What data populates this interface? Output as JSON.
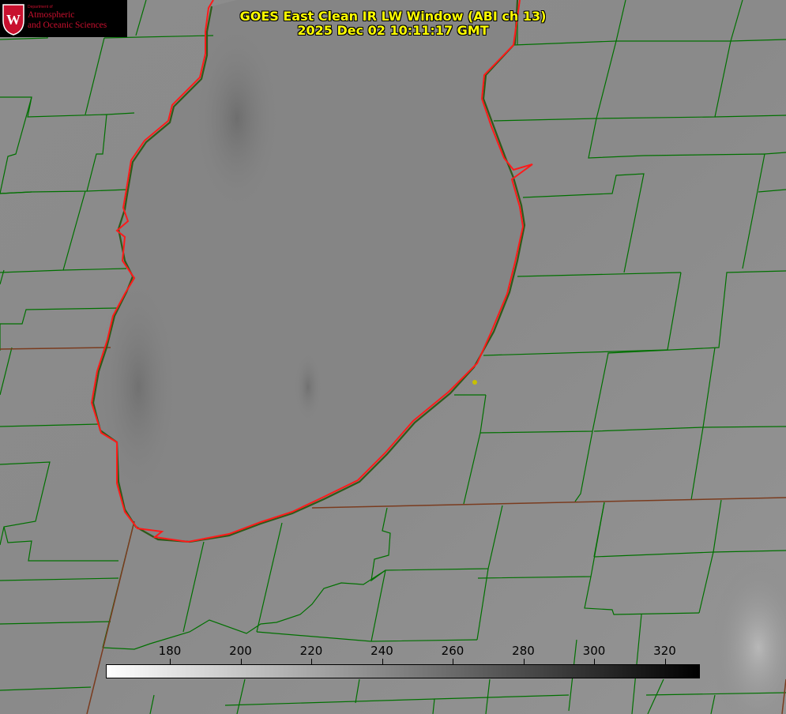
{
  "header": {
    "title_line1": "GOES East Clean IR LW Window (ABI ch 13)",
    "title_line2": "2025 Dec 02 10:11:17 GMT"
  },
  "logo": {
    "dept": "Department of",
    "line1": "Atmospheric",
    "line2": "and Oceanic Sciences",
    "seal_letter": "W"
  },
  "colorbar": {
    "ticks": [
      "180",
      "200",
      "220",
      "240",
      "260",
      "280",
      "300",
      "320"
    ],
    "gradient_from": "#ffffff",
    "gradient_to": "#000000"
  },
  "map_style": {
    "background": "#8a8a8a",
    "lake_fill": "#858585",
    "county_line_color": "#007000",
    "state_line_color": "#7a3b1e",
    "coastline_color": "#ff0000",
    "marker_color": "#c8c000"
  }
}
